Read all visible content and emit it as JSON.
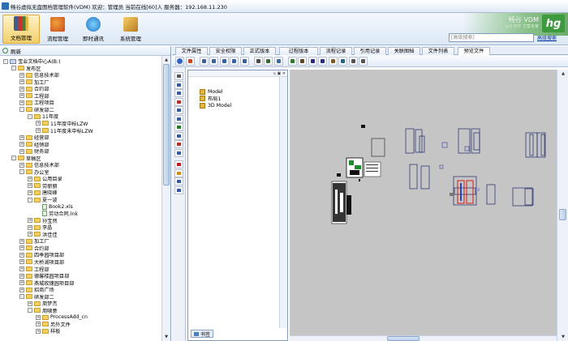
{
  "window": {
    "title": "畅谷虚拟无盘图档管理软件(VDM) 欢迎：管理员 当前在线[60]人 服务器：192.168.11.230"
  },
  "toolbar": {
    "buttons": [
      {
        "label": "文档管理",
        "icon": "document-management-icon",
        "color": "#4a6fa5",
        "active": true
      },
      {
        "label": "流程管理",
        "icon": "workflow-icon",
        "color": "#d25a2a",
        "active": false
      },
      {
        "label": "即时通讯",
        "icon": "instant-message-icon",
        "color": "#2f8fd6",
        "active": false
      },
      {
        "label": "系统管理",
        "icon": "system-admin-icon",
        "color": "#c28a2a",
        "active": false
      }
    ],
    "search_placeholder": "[高级搜索]",
    "advanced_search": "高级搜索"
  },
  "brand": {
    "name": "畅谷 VDM",
    "tagline": "设计协作  方案专家",
    "logo": "hg"
  },
  "left": {
    "refresh_label": "刷新",
    "tree": [
      {
        "label": "宝业文档中心A(B:)",
        "level": 0,
        "type": "root",
        "toggle": "-"
      },
      {
        "label": "发布区",
        "level": 1,
        "type": "folder",
        "toggle": "-"
      },
      {
        "label": "信息技术部",
        "level": 2,
        "type": "folder",
        "toggle": "+"
      },
      {
        "label": "加工厂",
        "level": 2,
        "type": "folder",
        "toggle": "+"
      },
      {
        "label": "合约部",
        "level": 2,
        "type": "folder",
        "toggle": "+"
      },
      {
        "label": "工程部",
        "level": 2,
        "type": "folder",
        "toggle": "+"
      },
      {
        "label": "工程项目",
        "level": 2,
        "type": "folder",
        "toggle": "+"
      },
      {
        "label": "研发部二",
        "level": 2,
        "type": "folder",
        "toggle": "-"
      },
      {
        "label": "11年度",
        "level": 3,
        "type": "folder",
        "toggle": "-"
      },
      {
        "label": "11年度中标LZW",
        "level": 4,
        "type": "folder",
        "toggle": "+"
      },
      {
        "label": "11年度未中标LZW",
        "level": 4,
        "type": "folder",
        "toggle": "+"
      },
      {
        "label": "经营部",
        "level": 2,
        "type": "folder",
        "toggle": "+"
      },
      {
        "label": "经销部",
        "level": 2,
        "type": "folder",
        "toggle": "+"
      },
      {
        "label": "财务部",
        "level": 2,
        "type": "folder",
        "toggle": "+"
      },
      {
        "label": "草稿区",
        "level": 1,
        "type": "folder",
        "toggle": "-"
      },
      {
        "label": "信息技术部",
        "level": 2,
        "type": "folder",
        "toggle": "+"
      },
      {
        "label": "办公室",
        "level": 2,
        "type": "folder",
        "toggle": "-"
      },
      {
        "label": "公用目录",
        "level": 3,
        "type": "folder",
        "toggle": "+"
      },
      {
        "label": "劳丽丽",
        "level": 3,
        "type": "folder",
        "toggle": "+"
      },
      {
        "label": "唐晓峰",
        "level": 3,
        "type": "folder",
        "toggle": "+"
      },
      {
        "label": "夏一波",
        "level": 3,
        "type": "folder",
        "toggle": "-"
      },
      {
        "label": "Book2.xls",
        "level": 4,
        "type": "file",
        "toggle": ""
      },
      {
        "label": "劳动合同.lnk",
        "level": 4,
        "type": "file",
        "toggle": ""
      },
      {
        "label": "孙宝然",
        "level": 3,
        "type": "folder",
        "toggle": "+"
      },
      {
        "label": "李晶",
        "level": 3,
        "type": "folder",
        "toggle": "+"
      },
      {
        "label": "洪佳佳",
        "level": 3,
        "type": "folder",
        "toggle": "+"
      },
      {
        "label": "加工厂",
        "level": 2,
        "type": "folder",
        "toggle": "+"
      },
      {
        "label": "合约部",
        "level": 2,
        "type": "folder",
        "toggle": "+"
      },
      {
        "label": "四季园项目部",
        "level": 2,
        "type": "folder",
        "toggle": "+"
      },
      {
        "label": "大桥湖项目部",
        "level": 2,
        "type": "folder",
        "toggle": "+"
      },
      {
        "label": "工程部",
        "level": 2,
        "type": "folder",
        "toggle": "+"
      },
      {
        "label": "德馨楼园项目部",
        "level": 2,
        "type": "folder",
        "toggle": "+"
      },
      {
        "label": "燕城玫瑰园项目部",
        "level": 2,
        "type": "folder",
        "toggle": "+"
      },
      {
        "label": "招商广场",
        "level": 2,
        "type": "folder",
        "toggle": "+"
      },
      {
        "label": "研发部二",
        "level": 2,
        "type": "folder",
        "toggle": "-"
      },
      {
        "label": "周梦杰",
        "level": 3,
        "type": "folder",
        "toggle": "+"
      },
      {
        "label": "周啸意",
        "level": 3,
        "type": "folder",
        "toggle": "-"
      },
      {
        "label": "ProcessAdd_cn",
        "level": 4,
        "type": "folder",
        "toggle": "+"
      },
      {
        "label": "另外文件",
        "level": 4,
        "type": "folder",
        "toggle": "+"
      },
      {
        "label": "样板",
        "level": 4,
        "type": "folder",
        "toggle": "+"
      }
    ]
  },
  "tabs": [
    {
      "label": "文件属性",
      "active": false
    },
    {
      "label": "安全权限",
      "active": false
    },
    {
      "label": "正式版本",
      "active": false
    },
    {
      "label": "过程版本",
      "active": false
    },
    {
      "label": "流程记录",
      "active": false
    },
    {
      "label": "引用记录",
      "active": false
    },
    {
      "label": "关联图档",
      "active": false
    },
    {
      "label": "文件列表",
      "active": false
    },
    {
      "label": "预览文件",
      "active": true
    }
  ],
  "structure": {
    "items": [
      {
        "label": "Model"
      },
      {
        "label": "布局1"
      },
      {
        "label": "3D Model"
      }
    ],
    "bookmark_tab": "书签",
    "window_buttons": "▫ ▣ ✕"
  },
  "colors": {
    "canvas_bg": "#c5c5c5",
    "title_grad": "#dfe9f5",
    "accent_green": "#3d9a3f"
  }
}
